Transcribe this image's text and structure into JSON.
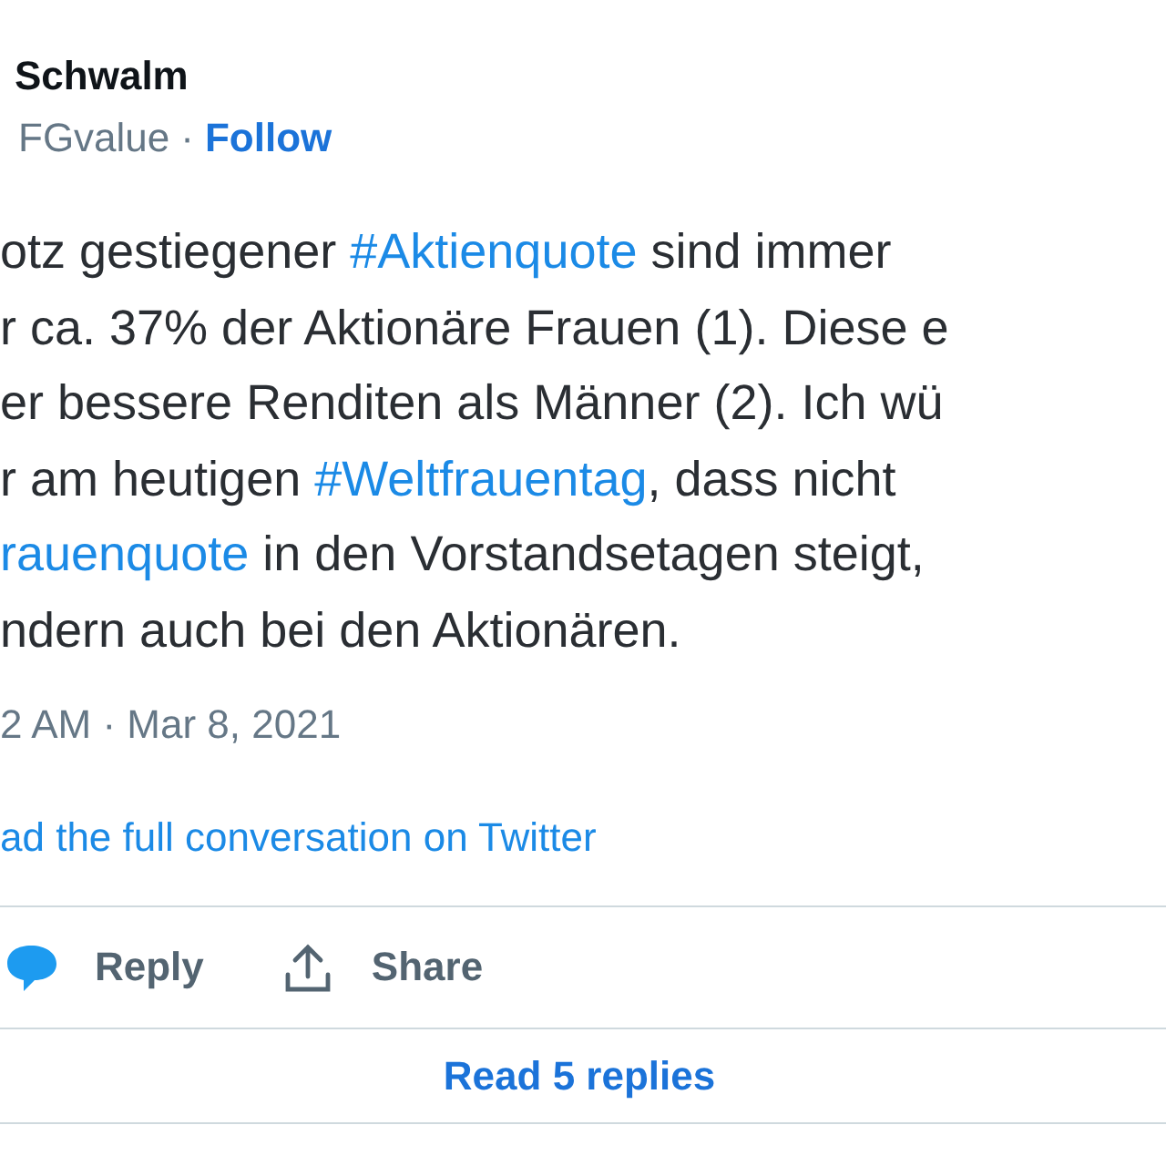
{
  "author": {
    "name": "Schwalm",
    "handle": "FGvalue",
    "separator": "·",
    "follow": "Follow"
  },
  "body_lines": [
    [
      {
        "kind": "text",
        "text": "otz gestiegener "
      },
      {
        "kind": "hashtag",
        "text": "#Aktienquote"
      },
      {
        "kind": "text",
        "text": " sind immer"
      }
    ],
    [
      {
        "kind": "text",
        "text": "r ca. 37% der Aktionäre Frauen (1). Diese e"
      }
    ],
    [
      {
        "kind": "text",
        "text": "er bessere Renditen als Männer (2). Ich wü"
      }
    ],
    [
      {
        "kind": "text",
        "text": "r am heutigen "
      },
      {
        "kind": "hashtag",
        "text": "#Weltfrauentag"
      },
      {
        "kind": "text",
        "text": ", dass nicht"
      }
    ],
    [
      {
        "kind": "hashtag",
        "text": "rauenquote"
      },
      {
        "kind": "text",
        "text": " in den Vorstandsetagen steigt,"
      }
    ],
    [
      {
        "kind": "text",
        "text": "ndern auch bei den Aktionären."
      }
    ]
  ],
  "timestamp": "2 AM · Mar 8, 2021",
  "conversation_link": "ad the full conversation on Twitter",
  "actions": [
    {
      "kind": "reply",
      "label": "Reply"
    },
    {
      "kind": "share",
      "label": "Share"
    }
  ],
  "read_replies": "Read 5 replies"
}
